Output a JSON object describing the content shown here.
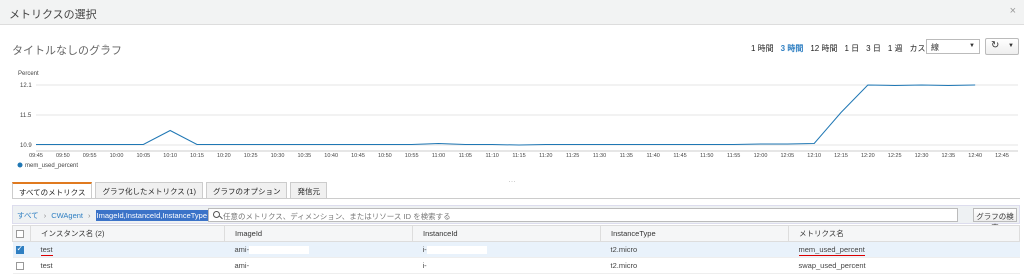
{
  "modal": {
    "title": "メトリクスの選択",
    "close": "×"
  },
  "graph": {
    "title": "タイトルなしのグラフ",
    "edit_icon": "pencil-icon"
  },
  "time_range": {
    "options": [
      "1 時間",
      "3 時間",
      "12 時間",
      "1 日",
      "3 日",
      "1 週",
      "カスタム"
    ],
    "active": "3 時間"
  },
  "period_select": {
    "value": "線"
  },
  "chart_data": {
    "type": "line",
    "ylabel": "Percent",
    "y_ticks": [
      "12.1",
      "11.5",
      "10.9"
    ],
    "ylim": [
      10.9,
      12.1
    ],
    "x": [
      "09:45",
      "09:50",
      "09:55",
      "10:00",
      "10:05",
      "10:10",
      "10:15",
      "10:20",
      "10:25",
      "10:30",
      "10:35",
      "10:40",
      "10:45",
      "10:50",
      "10:55",
      "11:00",
      "11:05",
      "11:10",
      "11:15",
      "11:20",
      "11:25",
      "11:30",
      "11:35",
      "11:40",
      "11:45",
      "11:50",
      "11:55",
      "12:00",
      "12:05",
      "12:10",
      "12:15",
      "12:20",
      "12:25",
      "12:30",
      "12:35",
      "12:40",
      "12:45"
    ],
    "series": [
      {
        "name": "mem_used_percent",
        "color": "#1f77b4",
        "values": [
          10.91,
          10.91,
          10.91,
          10.91,
          10.91,
          11.19,
          10.91,
          10.91,
          10.91,
          10.91,
          10.91,
          10.91,
          10.91,
          10.91,
          10.91,
          10.93,
          10.91,
          10.91,
          10.9,
          10.91,
          10.91,
          10.91,
          10.91,
          10.91,
          10.91,
          10.91,
          10.91,
          10.92,
          10.92,
          10.93,
          11.55,
          12.1,
          12.09,
          12.1,
          12.09,
          12.1
        ]
      }
    ],
    "grid": true,
    "legend": "bottom-left"
  },
  "tabs": [
    "すべてのメトリクス",
    "グラフ化したメトリクス (1)",
    "グラフのオプション",
    "発信元"
  ],
  "breadcrumb": {
    "all": "すべて",
    "sep": "›",
    "namespace": "CWAgent",
    "dimension": "ImageId,InstanceId,InstanceType"
  },
  "search": {
    "placeholder": "任意のメトリクス、ディメンション、またはリソース ID を検索する",
    "button": "グラフの検索"
  },
  "table": {
    "headers": [
      "インスタンス名 (2)",
      "ImageId",
      "InstanceId",
      "InstanceType",
      "メトリクス名"
    ],
    "rows": [
      {
        "checked": true,
        "name": "test",
        "image": "ami-",
        "instance": "i-",
        "type": "t2.micro",
        "metric": "mem_used_percent"
      },
      {
        "checked": false,
        "name": "test",
        "image": "ami-",
        "instance": "i-",
        "type": "t2.micro",
        "metric": "swap_used_percent"
      }
    ]
  }
}
